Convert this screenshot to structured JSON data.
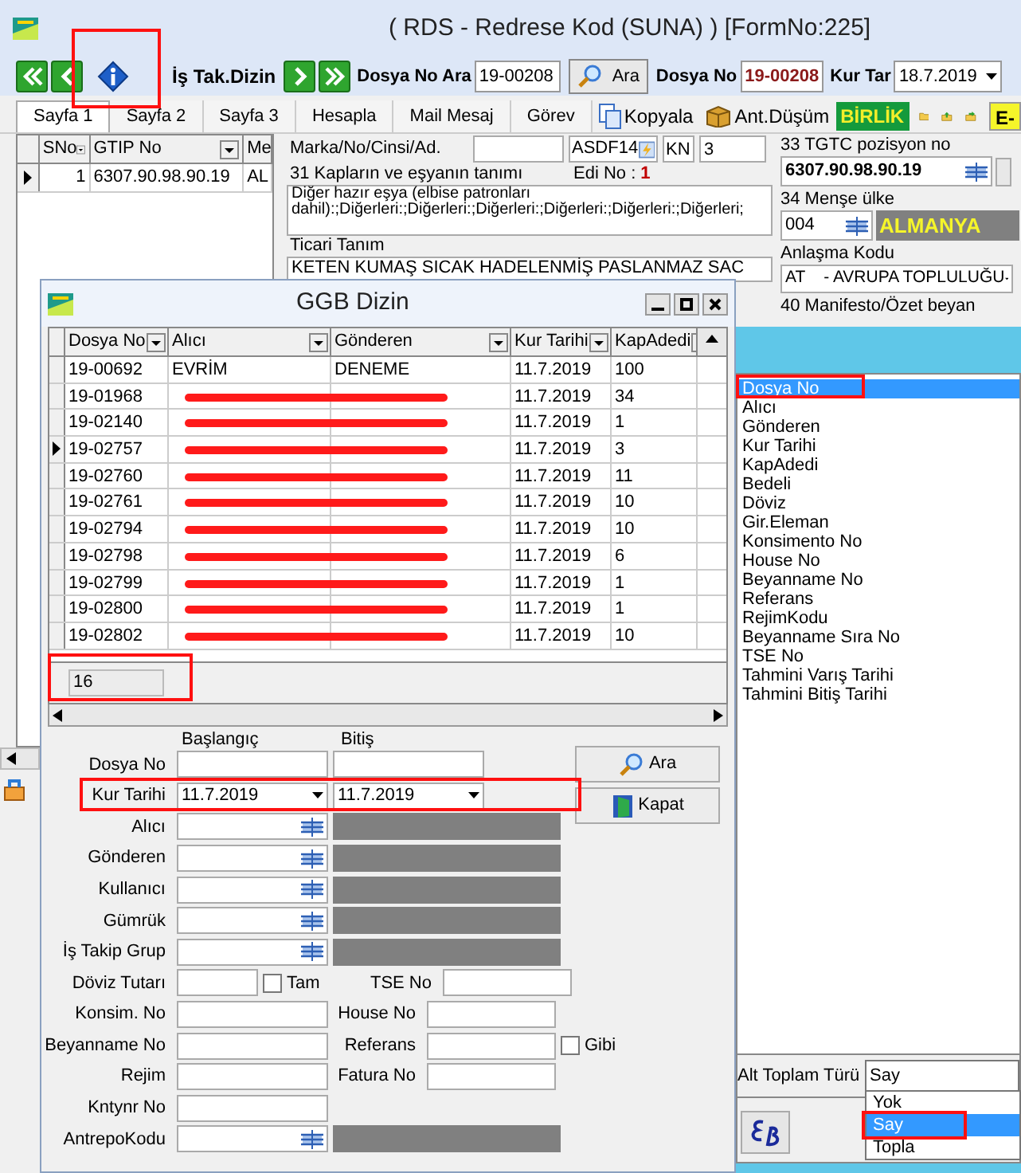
{
  "window": {
    "title": "( RDS - Redrese Kod (SUNA) ) [FormNo:225]"
  },
  "toolbar": {
    "dizin_label": "İş Tak.Dizin",
    "search_label": "Dosya No Ara",
    "search_value": "19-00208",
    "search_button": "Ara",
    "dosya_label": "Dosya No",
    "dosya_value": "19-00208",
    "kur_label": "Kur Tar",
    "kur_value": "18.7.2019"
  },
  "tabs": [
    {
      "label": "Sayfa 1",
      "selected": true
    },
    {
      "label": "Sayfa 2",
      "selected": false
    },
    {
      "label": "Sayfa 3",
      "selected": false
    },
    {
      "label": "Hesapla",
      "selected": false
    },
    {
      "label": "Mail Mesaj",
      "selected": false
    },
    {
      "label": "Görev",
      "selected": false
    }
  ],
  "tools": [
    {
      "kind": "copy",
      "label": "Kopyala"
    },
    {
      "kind": "box",
      "label": "Ant.Düşüm"
    },
    {
      "kind": "badge",
      "label": "BİRLİK"
    },
    {
      "kind": "folder"
    },
    {
      "kind": "upload"
    },
    {
      "kind": "export"
    },
    {
      "kind": "tag",
      "label": "E-"
    }
  ],
  "item_grid": {
    "columns": [
      "SNo",
      "GTIP No",
      "Me"
    ],
    "rows": [
      [
        "1",
        "6307.90.98.90.19",
        "AL"
      ]
    ]
  },
  "detail": {
    "marka_label": "Marka/No/Cinsi/Ad.",
    "marka_code": "ASDF14",
    "unit": "KN",
    "count": "3",
    "desc_label": "31 Kapların ve eşyanın tanımı",
    "edi_label": "Edi No :",
    "edi_value": "1",
    "description": "Diğer hazır eşya (elbise patronları dahil):;Diğerleri:;Diğerleri:;Diğerleri:;Diğerleri:;Diğerleri:;Diğerleri;",
    "trade_label": "Ticari Tanım",
    "trade_value": "KETEN KUMAŞ SICAK HADELENMİŞ PASLANMAZ SAC",
    "gtip_label": "33 TGTC pozisyon no",
    "gtip_value": "6307.90.98.90.19",
    "origin_label": "34 Menşe ülke",
    "origin_code": "004",
    "origin_name": "ALMANYA",
    "agreement_label": "Anlaşma Kodu",
    "agreement_value": "AT    - AVRUPA TOPLULUĞU",
    "manifest_label": "40 Manifesto/Özet beyan"
  },
  "dialog": {
    "title": "GGB Dizin",
    "grid": {
      "columns": [
        "Dosya No",
        "Alıcı",
        "Gönderen",
        "Kur Tarihi",
        "KapAdedi"
      ],
      "rows": [
        {
          "dosya": "19-00692",
          "alici": "EVRİM",
          "gonderen": "DENEME",
          "tarih": "11.7.2019",
          "adet": "100",
          "redacted": false,
          "current": false
        },
        {
          "dosya": "19-01968",
          "tarih": "11.7.2019",
          "adet": "34",
          "redacted": true,
          "current": false
        },
        {
          "dosya": "19-02140",
          "tarih": "11.7.2019",
          "adet": "1",
          "redacted": true,
          "current": false
        },
        {
          "dosya": "19-02757",
          "tarih": "11.7.2019",
          "adet": "3",
          "redacted": true,
          "current": true
        },
        {
          "dosya": "19-02760",
          "tarih": "11.7.2019",
          "adet": "11",
          "redacted": true,
          "current": false
        },
        {
          "dosya": "19-02761",
          "tarih": "11.7.2019",
          "adet": "10",
          "redacted": true,
          "current": false
        },
        {
          "dosya": "19-02794",
          "tarih": "11.7.2019",
          "adet": "10",
          "redacted": true,
          "current": false
        },
        {
          "dosya": "19-02798",
          "tarih": "11.7.2019",
          "adet": "6",
          "redacted": true,
          "current": false
        },
        {
          "dosya": "19-02799",
          "tarih": "11.7.2019",
          "adet": "1",
          "redacted": true,
          "current": false
        },
        {
          "dosya": "19-02800",
          "tarih": "11.7.2019",
          "adet": "1",
          "redacted": true,
          "current": false
        },
        {
          "dosya": "19-02802",
          "tarih": "11.7.2019",
          "adet": "10",
          "redacted": true,
          "current": false
        }
      ],
      "count": "16"
    },
    "form": {
      "col_start": "Başlangıç",
      "col_end": "Bitiş",
      "rows": [
        {
          "kind": "range",
          "label": "Dosya No"
        },
        {
          "kind": "date_range",
          "label": "Kur Tarihi",
          "start": "11.7.2019",
          "end": "11.7.2019"
        },
        {
          "kind": "lookup",
          "label": "Alıcı"
        },
        {
          "kind": "lookup",
          "label": "Gönderen"
        },
        {
          "kind": "lookup",
          "label": "Kullanıcı"
        },
        {
          "kind": "lookup",
          "label": "Gümrük"
        },
        {
          "kind": "lookup",
          "label": "İş Takip Grup"
        },
        {
          "kind": "pair_check_left",
          "label": "Döviz Tutarı",
          "check_label": "Tam",
          "checked": false,
          "label2": "TSE No"
        },
        {
          "kind": "pair",
          "label": "Konsim. No",
          "label2": "House No"
        },
        {
          "kind": "pair_check_right",
          "label": "Beyanname No",
          "label2": "Referans",
          "check_label": "Gibi",
          "checked": false
        },
        {
          "kind": "pair",
          "label": "Rejim",
          "label2": "Fatura No"
        },
        {
          "kind": "single",
          "label": "Kntynr No"
        },
        {
          "kind": "lookup",
          "label": "AntrepoKodu"
        }
      ]
    },
    "buttons": [
      {
        "kind": "search",
        "label": "Ara"
      },
      {
        "kind": "exit",
        "label": "Kapat"
      }
    ]
  },
  "columns_panel": {
    "items": [
      {
        "label": "Dosya No",
        "selected": true
      },
      {
        "label": "Alıcı",
        "selected": false
      },
      {
        "label": "Gönderen",
        "selected": false
      },
      {
        "label": "Kur Tarihi",
        "selected": false
      },
      {
        "label": "KapAdedi",
        "selected": false
      },
      {
        "label": "Bedeli",
        "selected": false
      },
      {
        "label": "Döviz",
        "selected": false
      },
      {
        "label": "Gir.Eleman",
        "selected": false
      },
      {
        "label": "Konsimento No",
        "selected": false
      },
      {
        "label": "House No",
        "selected": false
      },
      {
        "label": "Beyanname No",
        "selected": false
      },
      {
        "label": "Referans",
        "selected": false
      },
      {
        "label": "RejimKodu",
        "selected": false
      },
      {
        "label": "Beyanname Sıra No",
        "selected": false
      },
      {
        "label": "TSE No",
        "selected": false
      },
      {
        "label": "Tahmini Varış Tarihi",
        "selected": false
      },
      {
        "label": "Tahmini Bitiş Tarihi",
        "selected": false
      }
    ],
    "subtotal_label": "Alt Toplam Türü",
    "subtotal_value": "Say",
    "options": [
      {
        "label": "Yok",
        "selected": false
      },
      {
        "label": "Say",
        "selected": true
      },
      {
        "label": "Topla",
        "selected": false
      }
    ]
  }
}
